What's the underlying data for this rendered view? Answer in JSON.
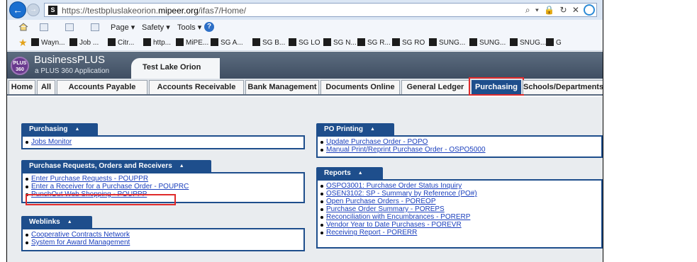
{
  "browser": {
    "url_prefix": "https://testbpluslakeorion.",
    "url_domain": "mipeer.org",
    "url_path": "/ifas7/Home/",
    "url_icons": "⌕ ▾ 🔒 ↻ ✕",
    "favicon": "S",
    "back_icon": "←",
    "forward_icon": "→",
    "command_bar": {
      "page_label": "Page ▾",
      "safety_label": "Safety ▾",
      "tools_label": "Tools ▾",
      "help_label": "?"
    },
    "favorites": [
      "Wayn...",
      "Job ...",
      "Citr...",
      "http...",
      "MiPE...",
      "SG A...",
      "SG B...",
      "SG LO",
      "SG N...",
      "SG R...",
      "SG RO",
      "SUNG...",
      "SUNG...",
      "SNUG...",
      "G"
    ]
  },
  "app": {
    "logo_text": "PLUS 360",
    "name": "BusinessPLUS",
    "subtitle": "a PLUS 360 Application",
    "site": "Test Lake Orion"
  },
  "nav": {
    "tabs": [
      "Home",
      "All",
      "Accounts Payable",
      "Accounts Receivable",
      "Bank Management",
      "Documents Online",
      "General Ledger",
      "Purchasing",
      "Schools/Departments"
    ],
    "active": "Purchasing"
  },
  "panels": {
    "purchasing": {
      "title": "Purchasing",
      "links": [
        "Jobs Monitor"
      ]
    },
    "requests": {
      "title": "Purchase Requests, Orders and Receivers",
      "links": [
        "Enter Purchase Requests - POUPPR",
        "Enter a Receiver for a Purchase Order - POUPRC",
        "PunchOut Web Shopping - POUPPP"
      ]
    },
    "weblinks": {
      "title": "Weblinks",
      "links": [
        "Cooperative Contracts Network",
        "System for Award Management"
      ]
    },
    "po_printing": {
      "title": "PO Printing",
      "links": [
        "Update Purchase Order - POPO",
        "Manual Print/Reprint Purchase Order - OSPO5000"
      ]
    },
    "reports": {
      "title": "Reports",
      "links": [
        "OSPO3001: Purchase Order Status Inquiry",
        "OSEN3102: SP - Summary by Reference (PO#)",
        "Open Purchase Orders - POREOP",
        "Purchase Order Summary - POREPS",
        "Reconciliation with Encumbrances - PORERP",
        "Vendor Year to Date Purchases - POREVR",
        "Receiving Report - PORERR"
      ]
    },
    "collapse_icon": "▲"
  }
}
